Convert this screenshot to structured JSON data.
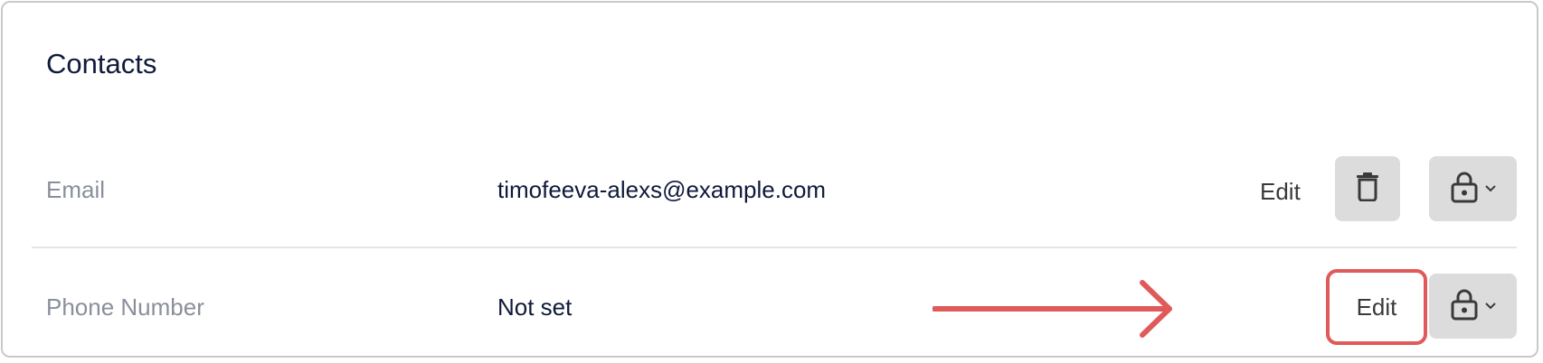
{
  "section": {
    "title": "Contacts"
  },
  "rows": [
    {
      "label": "Email",
      "value": "timofeeva-alexs@example.com",
      "edit_label": "Edit"
    },
    {
      "label": "Phone Number",
      "value": "Not set",
      "edit_label": "Edit"
    }
  ],
  "colors": {
    "highlight": "#e05a5a",
    "button_bg": "#dcdcdc",
    "title": "#0f1a3a",
    "label": "#8a8f9c"
  },
  "icons": {
    "delete": "trash-icon",
    "privacy": "lock-icon",
    "dropdown": "chevron-down-icon",
    "annotation": "arrow-right-icon"
  }
}
